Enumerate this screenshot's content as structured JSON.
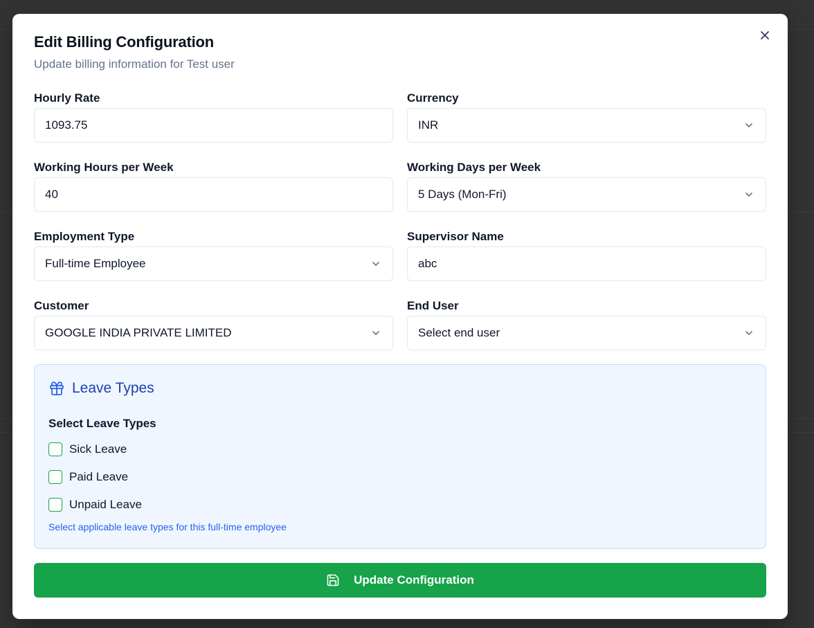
{
  "modal": {
    "title": "Edit Billing Configuration",
    "subtitle": "Update billing information for Test user",
    "close_icon": "close-icon"
  },
  "form": {
    "hourly_rate": {
      "label": "Hourly Rate",
      "value": "1093.75"
    },
    "currency": {
      "label": "Currency",
      "value": "INR"
    },
    "working_hours": {
      "label": "Working Hours per Week",
      "value": "40"
    },
    "working_days": {
      "label": "Working Days per Week",
      "value": "5 Days (Mon-Fri)"
    },
    "employment_type": {
      "label": "Employment Type",
      "value": "Full-time Employee"
    },
    "supervisor_name": {
      "label": "Supervisor Name",
      "value": "abc"
    },
    "customer": {
      "label": "Customer",
      "value": "GOOGLE INDIA PRIVATE LIMITED"
    },
    "end_user": {
      "label": "End User",
      "placeholder": "Select end user"
    }
  },
  "leave_types": {
    "title": "Leave Types",
    "icon": "gift-icon",
    "subtitle": "Select Leave Types",
    "options": [
      {
        "label": "Sick Leave",
        "checked": false
      },
      {
        "label": "Paid Leave",
        "checked": false
      },
      {
        "label": "Unpaid Leave",
        "checked": false
      }
    ],
    "hint": "Select applicable leave types for this full-time employee"
  },
  "actions": {
    "update_label": "Update Configuration",
    "update_icon": "save-icon"
  },
  "colors": {
    "primary_green": "#16a34a",
    "leave_panel_bg": "#eff6ff",
    "leave_title": "#1e40af",
    "hint_blue": "#2563eb"
  }
}
